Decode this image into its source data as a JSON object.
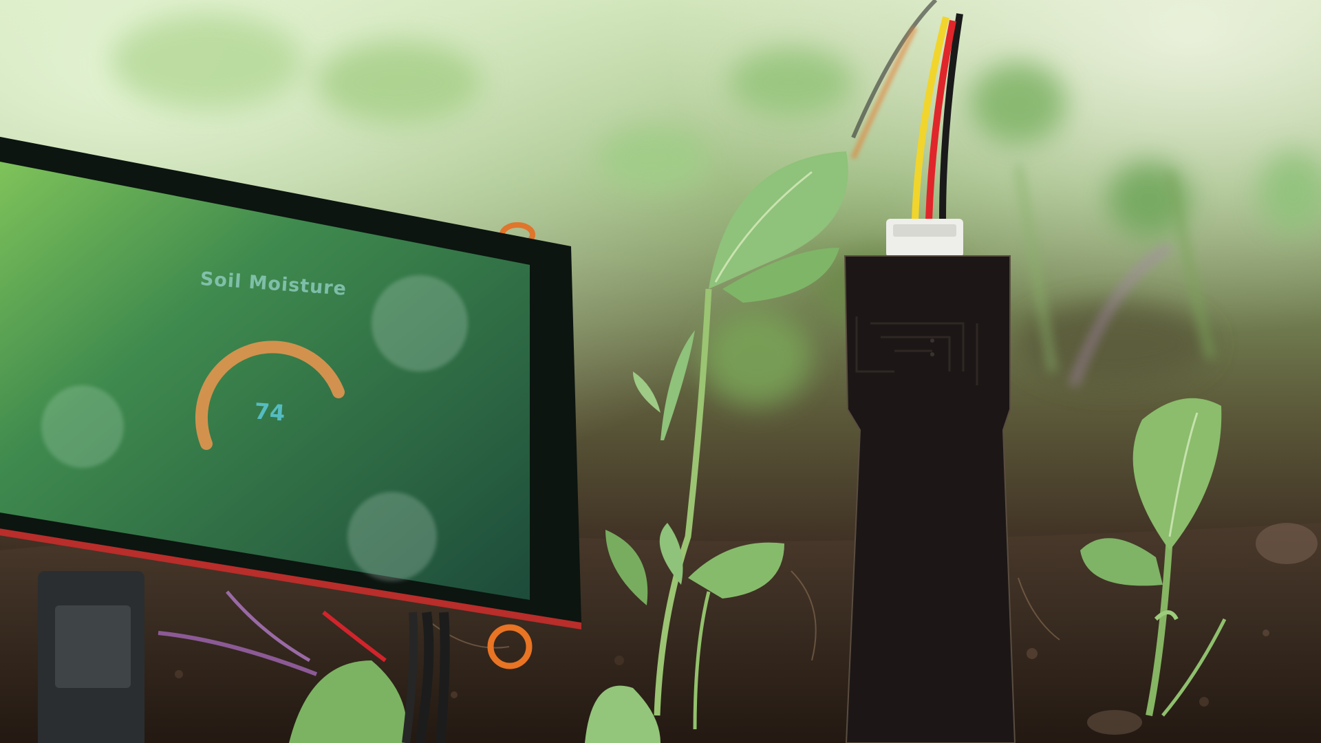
{
  "display": {
    "title": "Soil Moisture",
    "gauge": {
      "value": 74,
      "value_label": "74",
      "max": 100,
      "arc_color": "#e3954f"
    },
    "screen_color": "#2f6e4c",
    "bezel_color": "#0d1610"
  },
  "sensor": {
    "body_color": "#1c1716",
    "wires": [
      "#000000",
      "#e0262a",
      "#f1d52c"
    ]
  },
  "scene": {
    "soil_color": "#3a2a22",
    "foliage_color": "#8bbf6a"
  }
}
